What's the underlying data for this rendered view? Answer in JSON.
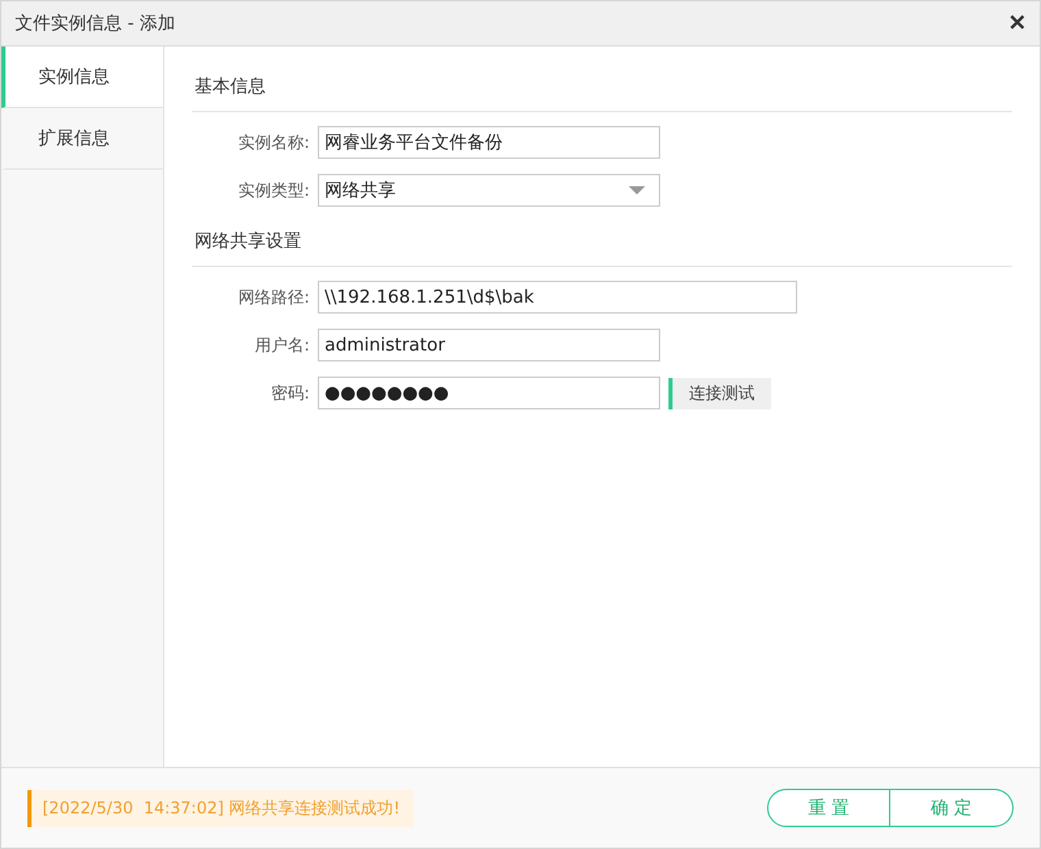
{
  "window": {
    "title": "文件实例信息 - 添加",
    "close": "✕"
  },
  "tabs": [
    {
      "label": "实例信息",
      "selected": true
    },
    {
      "label": "扩展信息",
      "selected": false
    }
  ],
  "sections": [
    {
      "title": "基本信息",
      "fields": [
        {
          "kind": "text",
          "label": "实例名称:",
          "value": "网睿业务平台文件备份"
        },
        {
          "kind": "select",
          "label": "实例类型:",
          "value": "网络共享"
        }
      ]
    },
    {
      "title": "网络共享设置",
      "fields": [
        {
          "kind": "wide",
          "label": "网络路径:",
          "value": "\\\\192.168.1.251\\d$\\bak"
        },
        {
          "kind": "text",
          "label": "用户名:",
          "value": "administrator"
        },
        {
          "kind": "password",
          "label": "密码:",
          "value": "●●●●●●●●",
          "button": "连接测试"
        }
      ]
    }
  ],
  "status_message": "[2022/5/30  14:37:02] 网络共享连接测试成功!",
  "buttons": [
    "重 置",
    "确 定"
  ]
}
